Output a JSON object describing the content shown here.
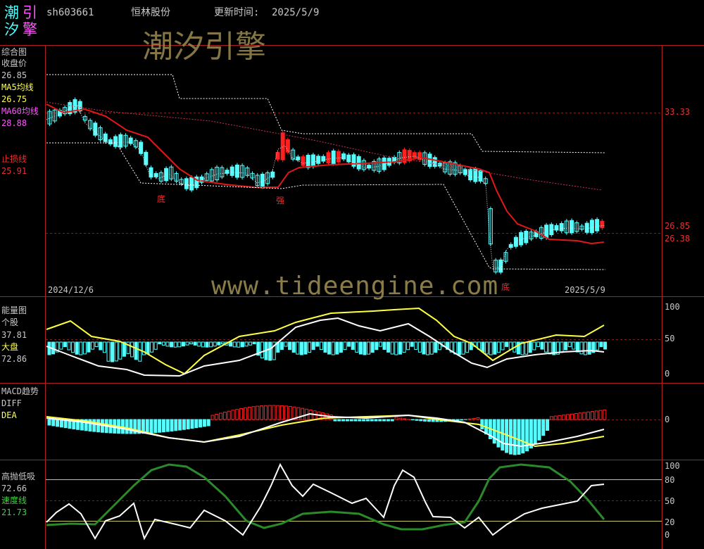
{
  "header": {
    "logo_chars": [
      "潮",
      "引",
      "汐",
      "擎"
    ],
    "code": "sh603661",
    "name": "恒林股份",
    "update_label": "更新时间:",
    "update_date": "2025/5/9"
  },
  "watermarks": {
    "brand": "潮汐引擎",
    "url": "www.tideengine.com"
  },
  "panel_main": {
    "title": "综合图",
    "close_label": "收盘价",
    "close_value": "26.85",
    "ma5_label": "MA5均线",
    "ma5_value": "26.75",
    "ma60_label": "MA60均线",
    "ma60_value": "28.88",
    "stop_label": "止损线",
    "stop_value": "25.91",
    "date_start": "2024/12/6",
    "date_end": "2025/5/9",
    "price_labels": [
      "33.33",
      "26.85",
      "26.38"
    ],
    "markers": [
      "底",
      "强",
      "底"
    ]
  },
  "panel_energy": {
    "title": "能量图",
    "stock_label": "个股",
    "stock_value": "37.81",
    "market_label": "大盘",
    "market_value": "72.86",
    "axis": [
      "100",
      "50",
      "0"
    ]
  },
  "panel_macd": {
    "title": "MACD趋势",
    "diff_label": "DIFF",
    "dea_label": "DEA",
    "axis": [
      "0"
    ]
  },
  "panel_osc": {
    "title": "高抛低吸",
    "value": "72.66",
    "speed_label": "速度线",
    "speed_value": "21.73",
    "axis": [
      "100",
      "80",
      "50",
      "20",
      "0"
    ]
  },
  "colors": {
    "red": "#e83030",
    "cyan": "#55ffff",
    "yellow": "#ffff55",
    "pink": "#ff55ff",
    "green": "#2a8a2a",
    "grid": "#8b1a1a"
  }
}
